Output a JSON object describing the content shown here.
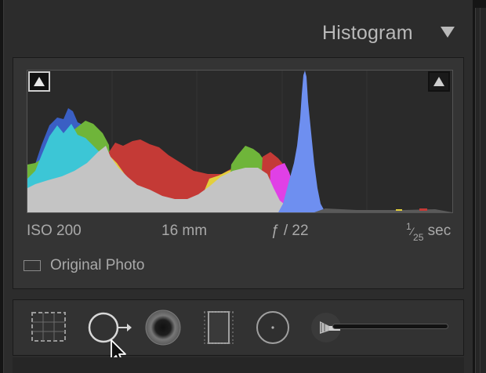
{
  "panel": {
    "title": "Histogram"
  },
  "info": {
    "iso": "ISO 200",
    "focal": "16 mm",
    "aperture": "ƒ / 22",
    "shutter_num": "1",
    "shutter_den": "25",
    "shutter_unit": "sec"
  },
  "original_photo": {
    "label": "Original Photo",
    "checked": false
  },
  "tools": [
    "crop-overlay-icon",
    "spot-removal-icon",
    "red-eye-icon",
    "graduated-filter-icon",
    "radial-filter-icon",
    "adjustment-brush-icon"
  ],
  "colors": {
    "gray": "#c4c4c4",
    "cyan": "#3cc6d6",
    "blue": "#3a5fc4",
    "green": "#6fb53a",
    "red": "#c43a36",
    "yellow": "#e3cf3c",
    "magenta": "#e040e6",
    "light_blue": "#6e8ff0"
  }
}
